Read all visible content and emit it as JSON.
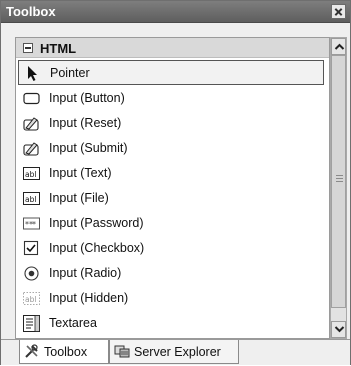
{
  "window": {
    "title": "Toolbox"
  },
  "group": {
    "label": "HTML"
  },
  "items": [
    {
      "label": "Pointer",
      "icon": "pointer-icon",
      "selected": true
    },
    {
      "label": "Input (Button)",
      "icon": "button-icon"
    },
    {
      "label": "Input (Reset)",
      "icon": "reset-icon"
    },
    {
      "label": "Input (Submit)",
      "icon": "submit-icon"
    },
    {
      "label": "Input (Text)",
      "icon": "textbox-icon"
    },
    {
      "label": "Input (File)",
      "icon": "file-input-icon"
    },
    {
      "label": "Input (Password)",
      "icon": "password-icon"
    },
    {
      "label": "Input (Checkbox)",
      "icon": "checkbox-icon"
    },
    {
      "label": "Input (Radio)",
      "icon": "radio-icon"
    },
    {
      "label": "Input (Hidden)",
      "icon": "hidden-input-icon"
    },
    {
      "label": "Textarea",
      "icon": "textarea-icon"
    }
  ],
  "tabs": [
    {
      "label": "Toolbox",
      "icon": "tools-icon",
      "active": true
    },
    {
      "label": "Server Explorer",
      "icon": "server-explorer-icon"
    }
  ]
}
